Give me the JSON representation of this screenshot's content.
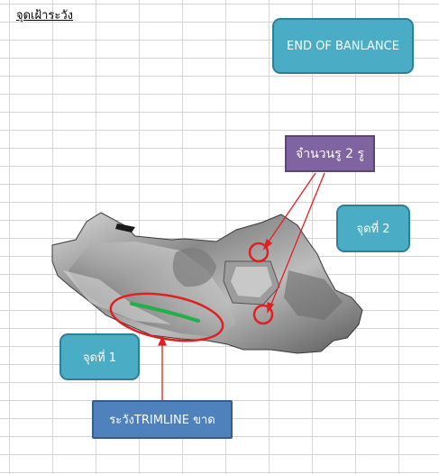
{
  "sheet": {
    "title": "จุดเฝ้าระวัง"
  },
  "callouts": {
    "end_of_balance": "END OF BANLANCE",
    "hole_count": "จำนวนรู 2 รู",
    "point_2": "จุดที่ 2",
    "point_1": "จุดที่ 1",
    "trimline_warning": "ระวังTRIMLINE ขาด"
  },
  "colors": {
    "callout_teal": "#4bacc6",
    "callout_purple": "#8064a2",
    "callout_blue": "#4f81bd",
    "marker_red": "#e02020",
    "trimline_green": "#22b04a"
  },
  "icons": {
    "part_image": "metal-part-image"
  }
}
